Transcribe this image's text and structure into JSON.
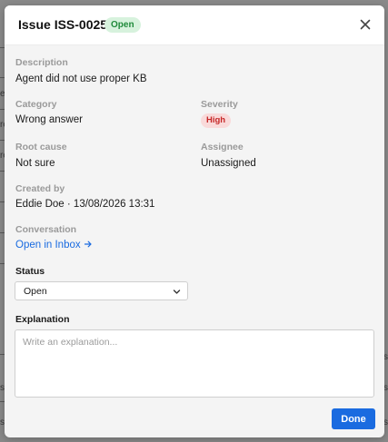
{
  "modal": {
    "title": "Issue ISS-0025",
    "status_badge": "Open",
    "close_icon": "close-icon"
  },
  "fields": {
    "description": {
      "label": "Description",
      "value": "Agent did not use proper KB"
    },
    "category": {
      "label": "Category",
      "value": "Wrong answer"
    },
    "severity": {
      "label": "Severity",
      "value": "High"
    },
    "root_cause": {
      "label": "Root cause",
      "value": "Not sure"
    },
    "assignee": {
      "label": "Assignee",
      "value": "Unassigned"
    },
    "created_by": {
      "label": "Created by",
      "value": "Eddie Doe · 13/08/2026 13:31"
    },
    "conversation": {
      "label": "Conversation",
      "link_text": "Open in Inbox",
      "link_icon": "arrow-right-icon"
    }
  },
  "form": {
    "status": {
      "label": "Status",
      "selected": "Open",
      "chevron_icon": "chevron-down-icon"
    },
    "explanation": {
      "label": "Explanation",
      "value": "",
      "placeholder": "Write an explanation..."
    },
    "done_label": "Done"
  },
  "colors": {
    "accent": "#1a6be0",
    "open_badge_bg": "#d7f2dd",
    "open_badge_text": "#1f8a3a",
    "high_badge_bg": "#f9dada",
    "high_badge_text": "#c62828",
    "modal_bg": "#f4f4f4",
    "header_bg": "#ffffff"
  },
  "background_page": {
    "left_edge_chars": [
      "e",
      "re",
      "re",
      "s",
      "s"
    ],
    "right_edge_chars": [
      "s",
      "s",
      "s"
    ]
  }
}
